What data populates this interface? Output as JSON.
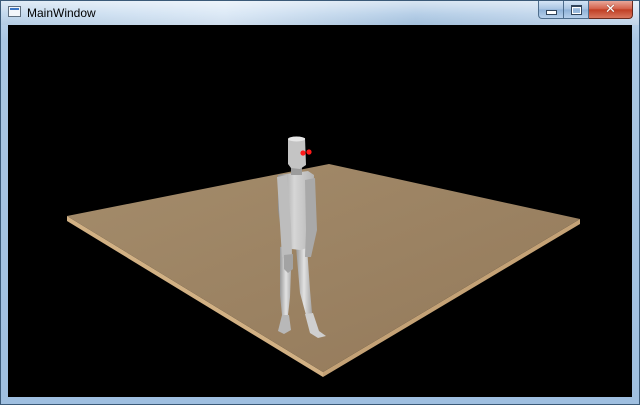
{
  "window": {
    "title": "MainWindow",
    "icon": "window-app-icon"
  },
  "caption_buttons": {
    "minimize_icon": "minimize-icon",
    "maximize_icon": "maximize-icon",
    "close_symbol": "✕"
  },
  "scene": {
    "background_color": "#000000",
    "floor_color": "#9c8565",
    "floor_edge_color": "#d2b184",
    "figure_color": "#c8c8c8",
    "eye_color": "#ff0000"
  }
}
